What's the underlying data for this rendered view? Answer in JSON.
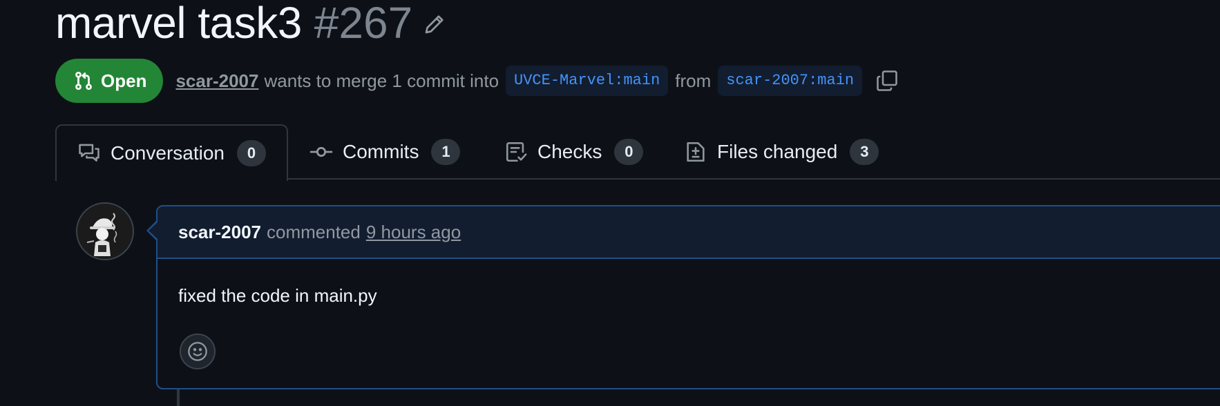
{
  "pr": {
    "title": "marvel task3",
    "number": "#267",
    "state": "Open",
    "author": "scar-2007",
    "merge_text": "wants to merge 1 commit into",
    "base_branch": "UVCE-Marvel:main",
    "from_text": "from",
    "head_branch": "scar-2007:main"
  },
  "tabs": [
    {
      "label": "Conversation",
      "count": "0",
      "icon": "comment-discussion-icon",
      "active": true
    },
    {
      "label": "Commits",
      "count": "1",
      "icon": "git-commit-icon",
      "active": false
    },
    {
      "label": "Checks",
      "count": "0",
      "icon": "checklist-icon",
      "active": false
    },
    {
      "label": "Files changed",
      "count": "3",
      "icon": "file-diff-icon",
      "active": false
    }
  ],
  "comment": {
    "author": "scar-2007",
    "verb": "commented",
    "time": "9 hours ago",
    "body": "fixed the code in main.py"
  },
  "colors": {
    "background": "#0d1117",
    "open_badge": "#238636",
    "branch_text": "#4493f8",
    "branch_bg": "#121d2f",
    "comment_border": "#1f4f8a",
    "comment_header_bg": "#121d2f",
    "muted_text": "#9198a1"
  }
}
